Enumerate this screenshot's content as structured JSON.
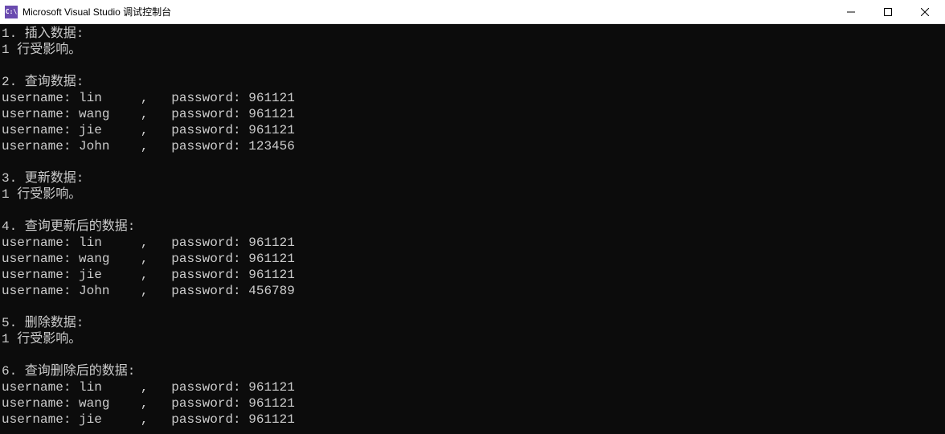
{
  "window": {
    "title": "Microsoft Visual Studio 调试控制台",
    "icon_label": "C:\\"
  },
  "console": {
    "sections": [
      {
        "header": "1. 插入数据:",
        "result": "1 行受影响。",
        "rows": []
      },
      {
        "header": "2. 查询数据:",
        "result": "",
        "rows": [
          {
            "username": "lin",
            "password": "961121"
          },
          {
            "username": "wang",
            "password": "961121"
          },
          {
            "username": "jie",
            "password": "961121"
          },
          {
            "username": "John",
            "password": "123456"
          }
        ]
      },
      {
        "header": "3. 更新数据:",
        "result": "1 行受影响。",
        "rows": []
      },
      {
        "header": "4. 查询更新后的数据:",
        "result": "",
        "rows": [
          {
            "username": "lin",
            "password": "961121"
          },
          {
            "username": "wang",
            "password": "961121"
          },
          {
            "username": "jie",
            "password": "961121"
          },
          {
            "username": "John",
            "password": "456789"
          }
        ]
      },
      {
        "header": "5. 删除数据:",
        "result": "1 行受影响。",
        "rows": []
      },
      {
        "header": "6. 查询删除后的数据:",
        "result": "",
        "rows": [
          {
            "username": "lin",
            "password": "961121"
          },
          {
            "username": "wang",
            "password": "961121"
          },
          {
            "username": "jie",
            "password": "961121"
          }
        ]
      }
    ],
    "labels": {
      "username": "username: ",
      "password": "password: "
    }
  }
}
